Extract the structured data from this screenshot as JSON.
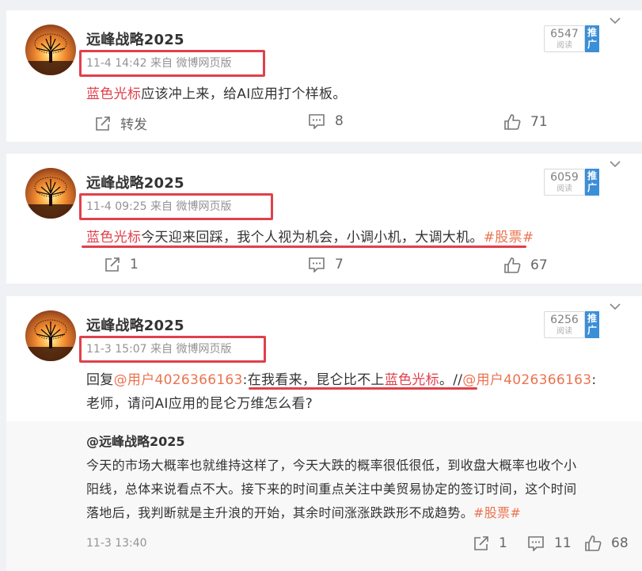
{
  "colors": {
    "highlight": "#e0404c",
    "topic_link": "#eb7350",
    "promo_badge": "#3b8fd8",
    "meta_gray": "#939393"
  },
  "posts": [
    {
      "author": "远峰战略2025",
      "meta": "11-4 14:42 来自 微博网页版",
      "views": "6547",
      "views_label": "阅读",
      "promo": "推广",
      "text_red": "蓝色光标",
      "text_rest": "应该冲上来，给AI应用打个样板。",
      "forward_label": "转发",
      "comments": "8",
      "likes": "71"
    },
    {
      "author": "远峰战略2025",
      "meta": "11-4 09:25 来自 微博网页版",
      "views": "6059",
      "views_label": "阅读",
      "promo": "推广",
      "text_red": "蓝色光标",
      "text_rest": "今天迎来回踩，我个人视为机会，小调小机，大调大机。",
      "text_topic": "#股票#",
      "forwards": "1",
      "comments": "7",
      "likes": "67"
    },
    {
      "author": "远峰战略2025",
      "meta": "11-3 15:07 来自 微博网页版",
      "views": "6256",
      "views_label": "阅读",
      "promo": "推广",
      "reply_prefix": "回复",
      "reply_user": "@用户4026366163",
      "reply_colon": ":",
      "reply_mid": "在我看来，昆仑比不上",
      "reply_red": "蓝色光标",
      "reply_end": "。//",
      "reply_user2": "@用户4026366163",
      "reply_colon2": ":",
      "line2": "老师，请问AI应用的昆仑万维怎么看?",
      "quote": {
        "author": "@远峰战略2025",
        "line1": "今天的市场大概率也就维持这样了，今天大跌的概率很低很低，到收盘大概率也收个小",
        "line2": "阳线，总体来说看点不大。接下来的时间重点关注中美贸易协定的签订时间，这个时间",
        "line3_text": "落地后，我判断就是主升浪的开始，其余时间涨涨跌跌形不成趋势。",
        "line3_topic": "#股票#",
        "date": "11-3 13:40",
        "forwards": "1",
        "comments": "11",
        "likes": "68"
      }
    }
  ]
}
